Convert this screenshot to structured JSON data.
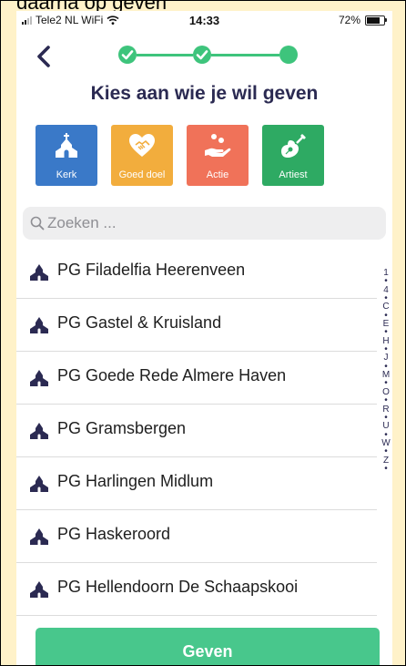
{
  "caption": "daarna op geven",
  "status_bar": {
    "carrier": "Tele2 NL WiFi",
    "time": "14:33",
    "battery_percent": "72%",
    "battery_level": 0.72
  },
  "nav": {
    "back_icon": "chevron-left-icon",
    "steps": [
      {
        "state": "complete",
        "icon": "check-icon"
      },
      {
        "state": "complete",
        "icon": "check-icon"
      },
      {
        "state": "current"
      }
    ]
  },
  "page_title": "Kies aan wie je wil geven",
  "categories": [
    {
      "label": "Kerk",
      "icon": "church-icon",
      "color": "#3a79c8"
    },
    {
      "label": "Goed doel",
      "icon": "heart-handshake-icon",
      "color": "#f2ad3d"
    },
    {
      "label": "Actie",
      "icon": "hand-coins-icon",
      "color": "#f07259"
    },
    {
      "label": "Artiest",
      "icon": "guitar-icon",
      "color": "#2eaa63"
    }
  ],
  "search": {
    "placeholder": "Zoeken ..."
  },
  "list_items": [
    {
      "name": "PG Filadelfia Heerenveen",
      "icon": "church-icon"
    },
    {
      "name": "PG Gastel & Kruisland",
      "icon": "church-icon"
    },
    {
      "name": "PG Goede Rede Almere Haven",
      "icon": "church-icon"
    },
    {
      "name": "PG Gramsbergen",
      "icon": "church-icon"
    },
    {
      "name": "PG Harlingen Midlum",
      "icon": "church-icon"
    },
    {
      "name": "PG Haskeroord",
      "icon": "church-icon"
    },
    {
      "name": "PG Hellendoorn De Schaapskooi",
      "icon": "church-icon"
    }
  ],
  "alphabet_index": [
    "1",
    "•",
    "4",
    "•",
    "C",
    "•",
    "E",
    "•",
    "H",
    "•",
    "J",
    "•",
    "M",
    "•",
    "O",
    "•",
    "R",
    "•",
    "U",
    "•",
    "W",
    "•",
    "Z",
    "•"
  ],
  "give_button": {
    "label": "Geven"
  },
  "colors": {
    "accent_green": "#3ec47c",
    "title": "#2b2a52",
    "button": "#48c78c"
  }
}
